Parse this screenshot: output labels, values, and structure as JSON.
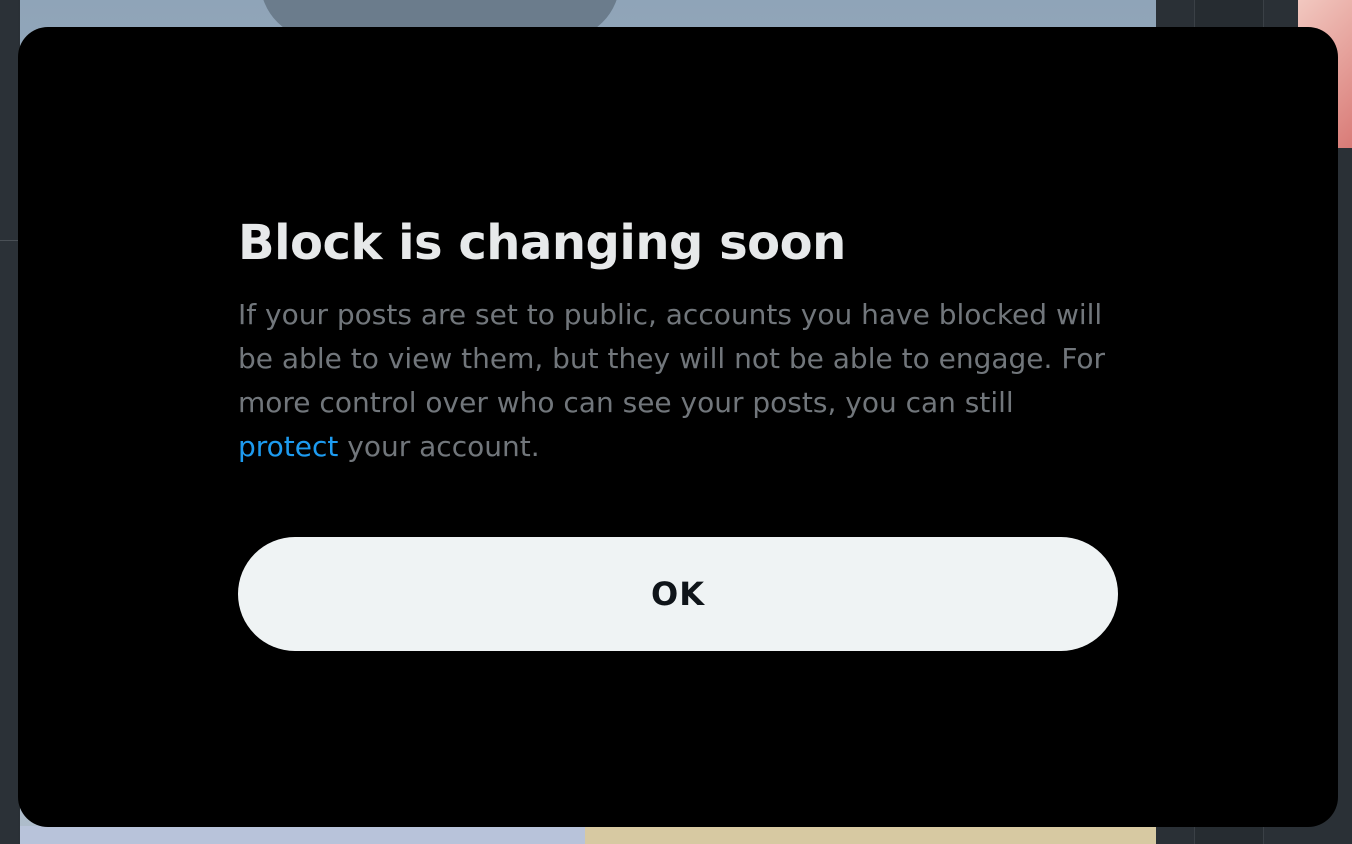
{
  "dialog": {
    "title": "Block is changing soon",
    "body_before_link": "If your posts are set to public, accounts you have blocked will be able to view them, but they will not be able to engage. For more control over who can see your posts, you can still ",
    "link_text": "protect",
    "body_after_link": " your account.",
    "ok_button_label": "OK"
  },
  "colors": {
    "modal_background": "#000000",
    "title": "#e7e9ea",
    "body_text": "#71767b",
    "link": "#1d9bf0",
    "button_background": "#eff3f4",
    "button_text": "#0f1419"
  }
}
